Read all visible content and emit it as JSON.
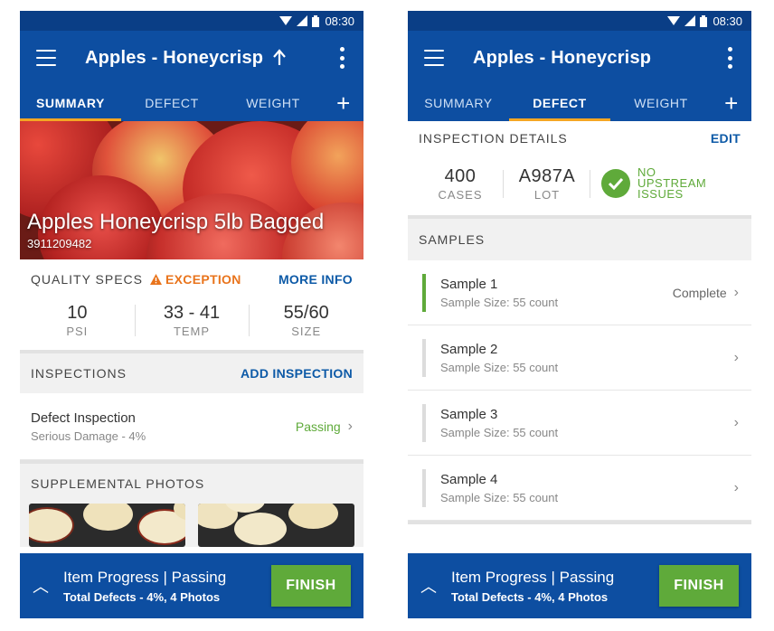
{
  "status": {
    "time": "08:30"
  },
  "colors": {
    "primary": "#0d4ea1",
    "accent_tab": "#f5a623",
    "success": "#5faa3a",
    "warning": "#e9741c",
    "link": "#0d5aa7"
  },
  "left": {
    "title": "Apples - Honeycrisp",
    "tabs": [
      "SUMMARY",
      "DEFECT",
      "WEIGHT"
    ],
    "hero": {
      "title": "Apples Honeycrisp 5lb Bagged",
      "code": "3911209482"
    },
    "quality_specs": {
      "label": "QUALITY SPECS",
      "exception": "EXCEPTION",
      "more_info": "MORE INFO",
      "specs": [
        {
          "value": "10",
          "label": "PSI"
        },
        {
          "value": "33 - 41",
          "label": "TEMP"
        },
        {
          "value": "55/60",
          "label": "SIZE"
        }
      ]
    },
    "inspections": {
      "label": "INSPECTIONS",
      "action": "ADD INSPECTION",
      "item": {
        "title": "Defect Inspection",
        "subtitle": "Serious Damage - 4%",
        "status": "Passing"
      }
    },
    "photos_label": "SUPPLEMENTAL PHOTOS",
    "bottom": {
      "line1": "Item Progress  |  Passing",
      "line2": "Total Defects - 4%, 4 Photos",
      "finish": "FINISH"
    }
  },
  "right": {
    "title": "Apples - Honeycrisp",
    "tabs": [
      "SUMMARY",
      "DEFECT",
      "WEIGHT"
    ],
    "details": {
      "label": "INSPECTION DETAILS",
      "action": "EDIT",
      "cases": {
        "value": "400",
        "label": "CASES"
      },
      "lot": {
        "value": "A987A",
        "label": "LOT"
      },
      "upstream": "NO UPSTREAM ISSUES"
    },
    "samples_label": "SAMPLES",
    "samples": [
      {
        "title": "Sample 1",
        "subtitle": "Sample Size: 55 count",
        "status": "Complete"
      },
      {
        "title": "Sample 2",
        "subtitle": "Sample Size: 55 count",
        "status": ""
      },
      {
        "title": "Sample 3",
        "subtitle": "Sample Size: 55 count",
        "status": ""
      },
      {
        "title": "Sample 4",
        "subtitle": "Sample Size: 55 count",
        "status": ""
      }
    ],
    "bottom": {
      "line1": "Item Progress  |  Passing",
      "line2": "Total Defects - 4%, 4 Photos",
      "finish": "FINISH"
    }
  }
}
